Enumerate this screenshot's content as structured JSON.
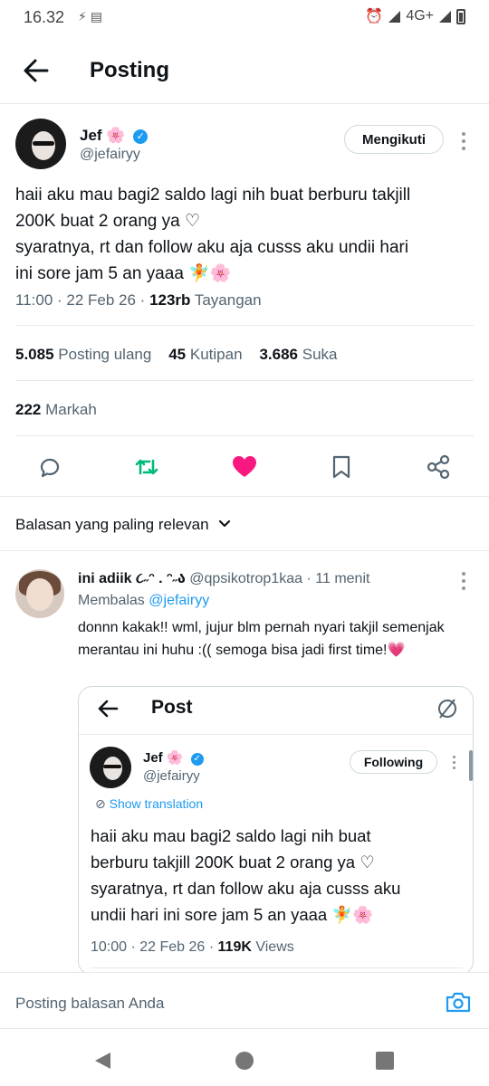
{
  "status_bar": {
    "time": "16.32",
    "network": "4G+"
  },
  "header": {
    "title": "Posting"
  },
  "tweet": {
    "author_name": "Jef",
    "author_emoji": "🌸",
    "handle": "@jefairyy",
    "follow_label": "Mengikuti",
    "text": "haii aku mau bagi2 saldo lagi nih buat berburu takjill\n200K buat 2 orang ya ♡\nsyaratnya, rt dan follow aku aja cusss aku undii hari\nini sore jam 5 an yaaa 🧚🌸",
    "time": "11:00 · 22 Feb 26 · ",
    "views_count": "123rb",
    "views_label": " Tayangan"
  },
  "stats": {
    "reposts_count": "5.085",
    "reposts_label": "Posting ulang",
    "quotes_count": "45",
    "quotes_label": "Kutipan",
    "likes_count": "3.686",
    "likes_label": "Suka",
    "bookmarks_count": "222",
    "bookmarks_label": "Markah"
  },
  "actions": [
    "reply-icon",
    "retweet-icon",
    "heart-icon",
    "bookmark-icon",
    "share-icon"
  ],
  "colors": {
    "retweet": "#00ba7c",
    "like": "#f91880",
    "link": "#1d9bf0",
    "muted": "#536471"
  },
  "replies": {
    "filter_label": "Balasan yang paling relevan"
  },
  "reply": {
    "author_name": "ini adiik ૮˶ᵔ . ᵔ˶ა",
    "handle": "@qpsikotrop1kaa",
    "time": "· 11 menit",
    "replying_prefix": "Membalas",
    "replying_handle": "@jefairyy",
    "text": "donnn kakak!! wml, jujur blm pernah nyari takjil semenjak merantau ini huhu :(( semoga bisa jadi first time!💗"
  },
  "embedded": {
    "title": "Post",
    "author_name": "Jef",
    "author_emoji": "🌸",
    "handle": "@jefairyy",
    "follow_label": "Following",
    "translate_label": "Show translation",
    "text": "haii aku mau bagi2 saldo lagi nih buat\nberburu takjill 200K buat 2 orang ya ♡\nsyaratnya, rt dan follow aku aja cusss aku\nundii hari ini sore jam 5 an yaaa 🧚🌸",
    "time": "10:00 · 22 Feb 26 · ",
    "views_count": "119K",
    "views_label": " Views"
  },
  "compose": {
    "placeholder": "Posting balasan Anda"
  }
}
